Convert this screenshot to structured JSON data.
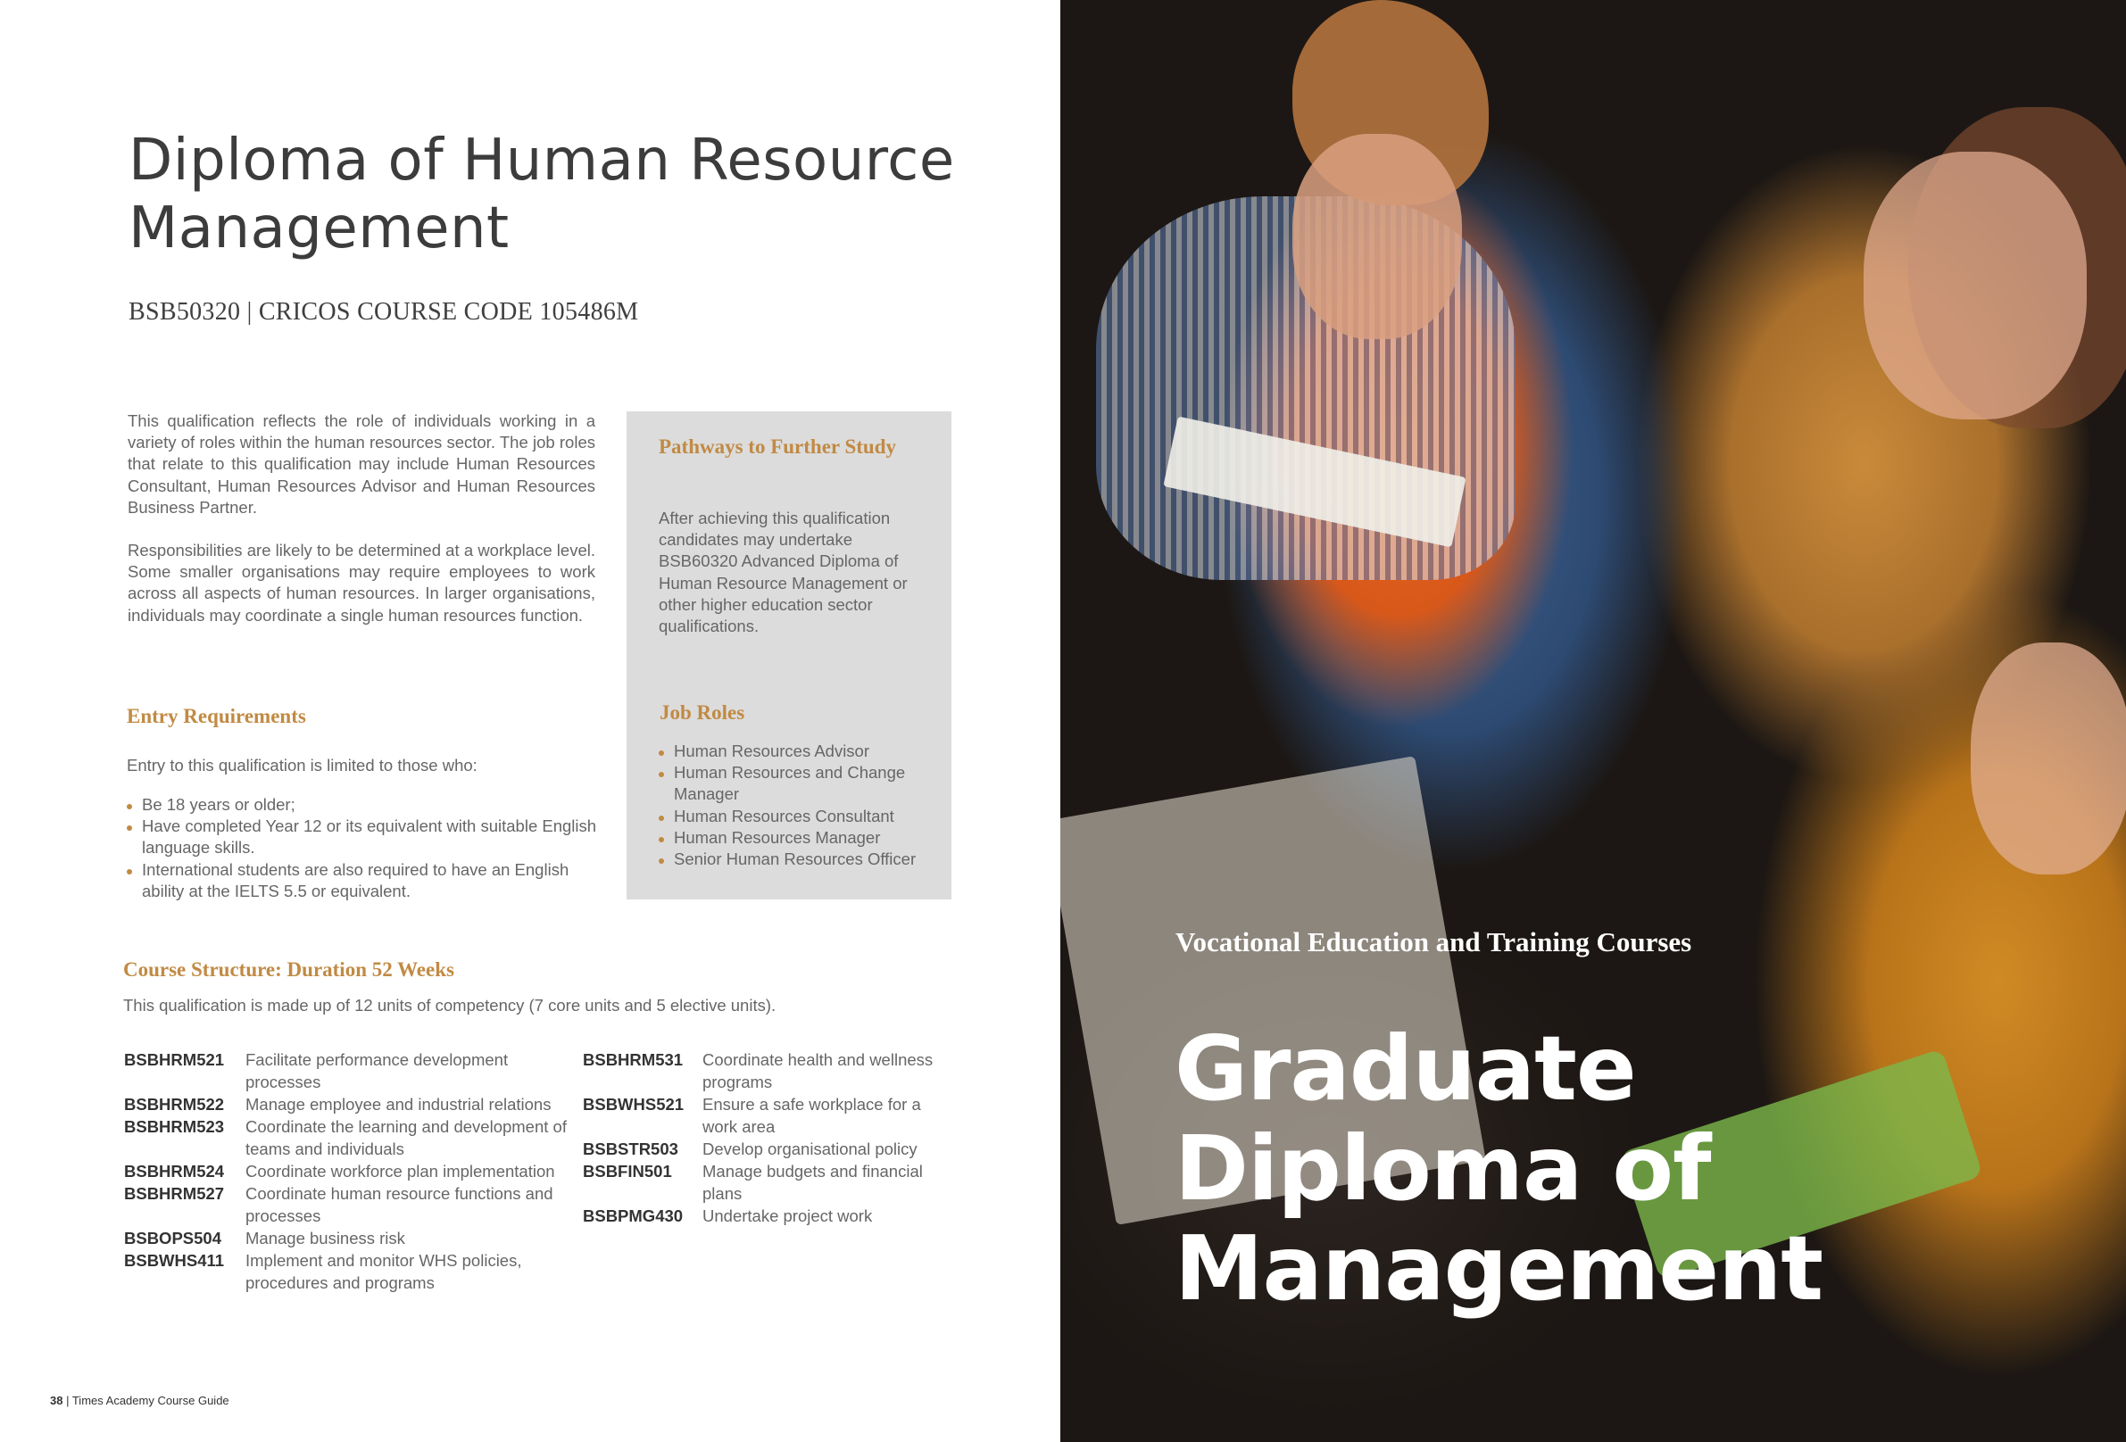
{
  "left_page": {
    "title": "Diploma of Human Resource Management",
    "course_code": "BSB50320 | CRICOS COURSE CODE 105486M",
    "intro_paragraphs": [
      "This qualification reflects the role of individuals working in a variety of roles within the human resources sector. The job roles that relate to this qualification may include Human Resources Consultant, Human Resources Advisor and Human Resources Business Partner.",
      "Responsibilities are likely to be determined at a workplace level. Some smaller organisations may require employees to work across all aspects of human resources. In larger organisations, individuals may coordinate a single human resources function."
    ],
    "entry": {
      "heading": "Entry Requirements",
      "intro": "Entry to this qualification is limited to those who:",
      "items": [
        "Be 18 years or older;",
        "Have completed Year 12 or its equivalent with suitable English language skills.",
        "International students are also required to have an English ability at the IELTS 5.5 or equivalent."
      ]
    },
    "sidebox": {
      "pathways_heading": "Pathways to Further Study",
      "pathways_text": "After achieving this qualification candidates may undertake BSB60320 Advanced Diploma of Human Resource Management or other higher education sector qualifications.",
      "roles_heading": "Job Roles",
      "roles": [
        "Human Resources Advisor",
        "Human Resources and Change Manager",
        "Human Resources Consultant",
        "Human Resources Manager",
        "Senior Human Resources Officer"
      ]
    },
    "course_structure": {
      "heading": "Course Structure: Duration 52 Weeks",
      "intro": "This qualification is made up of 12 units of competency (7 core units and 5 elective units).",
      "col1": [
        {
          "code": "BSBHRM521",
          "desc": "Facilitate performance development processes"
        },
        {
          "code": "BSBHRM522",
          "desc": "Manage employee and industrial relations"
        },
        {
          "code": "BSBHRM523",
          "desc": "Coordinate the learning and development of teams and individuals"
        },
        {
          "code": "BSBHRM524",
          "desc": "Coordinate workforce plan implementation"
        },
        {
          "code": "BSBHRM527",
          "desc": "Coordinate human resource functions and processes"
        },
        {
          "code": "BSBOPS504",
          "desc": "Manage business risk"
        },
        {
          "code": "BSBWHS411",
          "desc": "Implement and monitor WHS policies, procedures and programs"
        }
      ],
      "col2": [
        {
          "code": "BSBHRM531",
          "desc": "Coordinate health and wellness programs"
        },
        {
          "code": "BSBWHS521",
          "desc": "Ensure a safe workplace for a work area"
        },
        {
          "code": "BSBSTR503",
          "desc": "Develop organisational policy"
        },
        {
          "code": "BSBFIN501",
          "desc": "Manage budgets and financial plans"
        },
        {
          "code": "BSBPMG430",
          "desc": "Undertake project work"
        }
      ]
    },
    "footer": {
      "page_number": "38",
      "guide_title": "Times Academy Course Guide"
    }
  },
  "right_page": {
    "subheading": "Vocational Education and Training Courses",
    "heading": "Graduate Diploma of Management"
  },
  "colors": {
    "accent_gold": "#c18a43",
    "sidebox_bg": "#dcdcdc",
    "title_text": "#3c3c3c"
  }
}
